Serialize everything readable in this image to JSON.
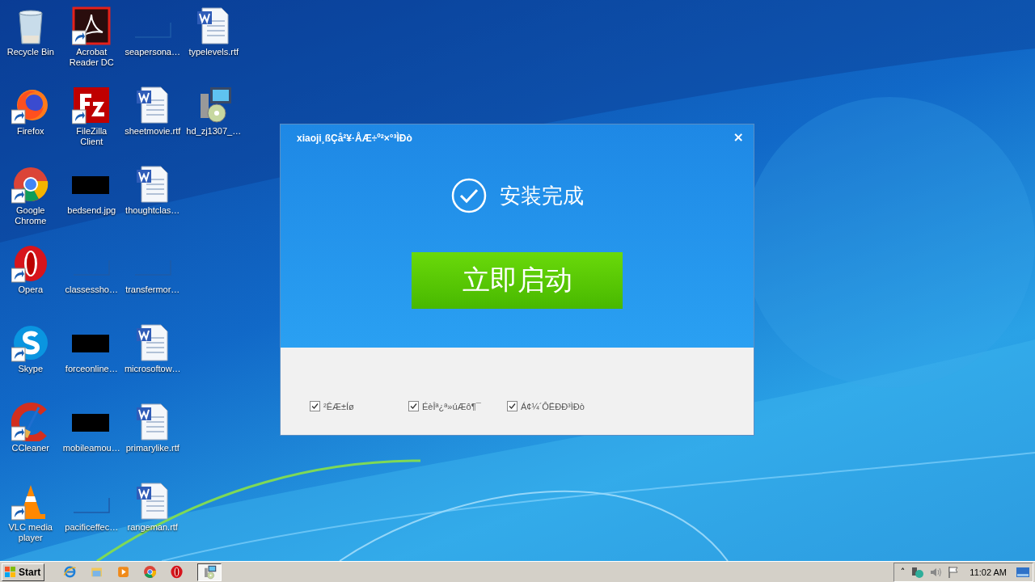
{
  "desktop": {
    "columns": [
      [
        {
          "label": "Recycle Bin",
          "kind": "recycle",
          "shortcut": false
        },
        {
          "label": "Firefox",
          "kind": "firefox",
          "shortcut": true
        },
        {
          "label": "Google Chrome",
          "kind": "chrome",
          "shortcut": true
        },
        {
          "label": "Opera",
          "kind": "opera",
          "shortcut": true
        },
        {
          "label": "Skype",
          "kind": "skype",
          "shortcut": true
        },
        {
          "label": "CCleaner",
          "kind": "ccleaner",
          "shortcut": true
        },
        {
          "label": "VLC media player",
          "kind": "vlc",
          "shortcut": true
        }
      ],
      [
        {
          "label": "Acrobat Reader DC",
          "kind": "acrobat",
          "shortcut": true
        },
        {
          "label": "FileZilla Client",
          "kind": "filezilla",
          "shortcut": true
        },
        {
          "label": "bedsend.jpg",
          "kind": "dark",
          "shortcut": false
        },
        {
          "label": "classessho…",
          "kind": "blank",
          "shortcut": false
        },
        {
          "label": "forceonline…",
          "kind": "dark",
          "shortcut": false
        },
        {
          "label": "mobileamou…",
          "kind": "dark",
          "shortcut": false
        },
        {
          "label": "pacificeffec…",
          "kind": "blank",
          "shortcut": false
        }
      ],
      [
        {
          "label": "seapersona…",
          "kind": "blank",
          "shortcut": false
        },
        {
          "label": "sheetmovie.rtf",
          "kind": "word",
          "shortcut": false
        },
        {
          "label": "thoughtclas…",
          "kind": "word",
          "shortcut": false
        },
        {
          "label": "transfermor…",
          "kind": "blank",
          "shortcut": false
        },
        {
          "label": "microsoftow…",
          "kind": "word",
          "shortcut": false
        },
        {
          "label": "primarylike.rtf",
          "kind": "word",
          "shortcut": false
        },
        {
          "label": "rangeman.rtf",
          "kind": "word",
          "shortcut": false
        }
      ],
      [
        {
          "label": "typelevels.rtf",
          "kind": "word",
          "shortcut": false
        },
        {
          "label": "hd_zj1307_…",
          "kind": "installer",
          "shortcut": false
        }
      ]
    ]
  },
  "dialog": {
    "title": "xiaoji¸ßÇå²¥·ÅÆ÷º²×°³ÌÐò",
    "close": "×",
    "status": "安装完成",
    "launch_button": "立即启动",
    "options": [
      {
        "label": "²ÊÆ±Íø",
        "checked": true
      },
      {
        "label": "ÉèÎª¿ª»úÆô¶¯",
        "checked": true
      },
      {
        "label": "Á¢¼´ÔËÐÐ³ÌÐò",
        "checked": true
      }
    ]
  },
  "taskbar": {
    "start": "Start",
    "quick_launch": [
      {
        "kind": "ie"
      },
      {
        "kind": "explorer"
      },
      {
        "kind": "media"
      },
      {
        "kind": "chrome"
      },
      {
        "kind": "opera"
      }
    ],
    "tasks": [
      {
        "kind": "installer",
        "selected": true
      }
    ],
    "tray": {
      "expand": "˄",
      "clock": "11:02 AM"
    }
  }
}
